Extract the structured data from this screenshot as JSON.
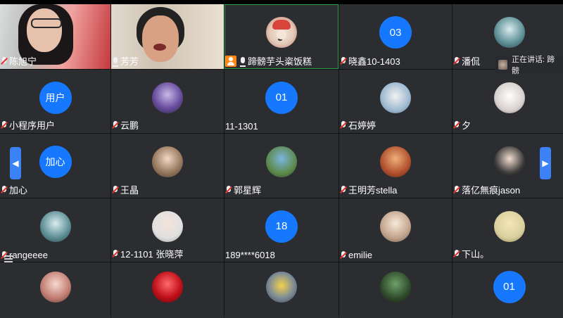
{
  "participants": [
    {
      "name": "陈旭宁",
      "mic": "off",
      "kind": "video"
    },
    {
      "name": "芳芳",
      "mic": "on",
      "kind": "video"
    },
    {
      "name": "蹄髈芋头粢饭糕",
      "mic": "on",
      "kind": "avatar",
      "host": true,
      "active": true
    },
    {
      "name": "晓鑫10-1403",
      "mic": "off",
      "kind": "initials",
      "initials": "03"
    },
    {
      "name": "潘侃",
      "mic": "off",
      "kind": "avatar"
    },
    {
      "name": "小程序用户",
      "mic": "off",
      "kind": "initials",
      "initials": "用户"
    },
    {
      "name": "云鹏",
      "mic": "off",
      "kind": "avatar"
    },
    {
      "name": "11-1301",
      "mic": "none",
      "kind": "initials",
      "initials": "01"
    },
    {
      "name": "石婷婷",
      "mic": "off",
      "kind": "avatar"
    },
    {
      "name": "夕",
      "mic": "off",
      "kind": "avatar"
    },
    {
      "name": "加心",
      "mic": "off",
      "kind": "initials",
      "initials": "加心"
    },
    {
      "name": "王晶",
      "mic": "off",
      "kind": "avatar"
    },
    {
      "name": "郭星辉",
      "mic": "off",
      "kind": "avatar"
    },
    {
      "name": "王明芳stella",
      "mic": "off",
      "kind": "avatar"
    },
    {
      "name": "落亿無痕jason𝅺",
      "mic": "off",
      "kind": "avatar"
    },
    {
      "name": "rangeeee",
      "mic": "off",
      "kind": "avatar"
    },
    {
      "name": "12-1101 张晓萍",
      "mic": "off",
      "kind": "avatar"
    },
    {
      "name": "189****6018",
      "mic": "none",
      "kind": "initials",
      "initials": "18"
    },
    {
      "name": "emilie",
      "mic": "off",
      "kind": "avatar"
    },
    {
      "name": "下山。",
      "mic": "off",
      "kind": "avatar"
    },
    {
      "name": "",
      "mic": "none",
      "kind": "avatar"
    },
    {
      "name": "",
      "mic": "none",
      "kind": "avatar"
    },
    {
      "name": "",
      "mic": "none",
      "kind": "avatar"
    },
    {
      "name": "",
      "mic": "none",
      "kind": "avatar"
    },
    {
      "name": "",
      "mic": "none",
      "kind": "initials",
      "initials": "01"
    }
  ],
  "speaking_indicator": "正在讲话: 蹄髈",
  "nav": {
    "prev": "◀",
    "next": "▶"
  },
  "colors": {
    "bubble": "#1677ff",
    "tile": "#2b2d31",
    "active_border": "#2ea043",
    "host_badge": "#ff8a1c"
  }
}
